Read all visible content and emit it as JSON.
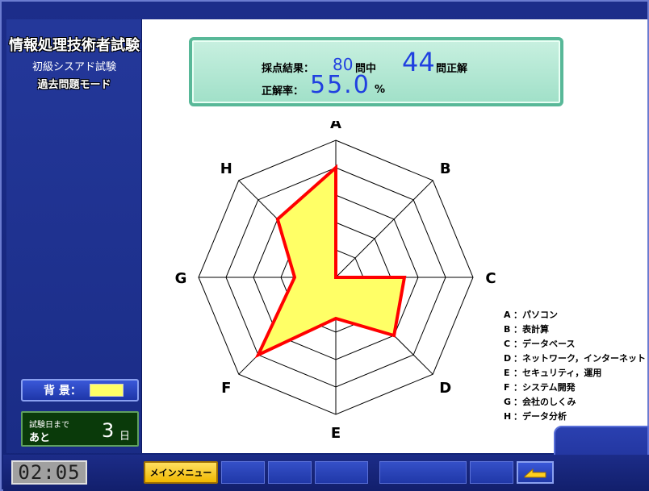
{
  "sidebar": {
    "title": "情報処理技術者試験",
    "subtitle": "初級シスアド試験",
    "mode": "過去問題モード",
    "background_label": "背 景：",
    "background_color": "#ffff66",
    "countdown": {
      "label_line1": "試験日まで",
      "label_line2": "あと",
      "days": "3",
      "unit": "日"
    }
  },
  "score": {
    "label": "採点結果：",
    "total": "80",
    "total_suffix": "問中",
    "correct": "44",
    "correct_suffix": "問正解",
    "rate_label": "正解率：",
    "rate_value": "55.0",
    "rate_unit": "%"
  },
  "chart_data": {
    "type": "radar",
    "categories": [
      "A",
      "B",
      "C",
      "D",
      "E",
      "F",
      "G",
      "H"
    ],
    "values": [
      0.8,
      0.0,
      0.5,
      0.6,
      0.3,
      0.8,
      0.3,
      0.6
    ],
    "rings": 5,
    "fill_color": "#ffff66",
    "line_color": "#ff0000"
  },
  "legend": [
    {
      "key": "A",
      "text": "：パソコン"
    },
    {
      "key": "B",
      "text": "：表計算"
    },
    {
      "key": "C",
      "text": "：データベース"
    },
    {
      "key": "D",
      "text": "：ネットワーク，インターネット"
    },
    {
      "key": "E",
      "text": "：セキュリティ，運用"
    },
    {
      "key": "F",
      "text": "：システム開発"
    },
    {
      "key": "G",
      "text": "：会社のしくみ"
    },
    {
      "key": "H",
      "text": "：データ分析"
    }
  ],
  "bottom_bar": {
    "clock": "02:05",
    "menu_label": "メインメニュー",
    "back_icon": "back-arrow-icon"
  }
}
